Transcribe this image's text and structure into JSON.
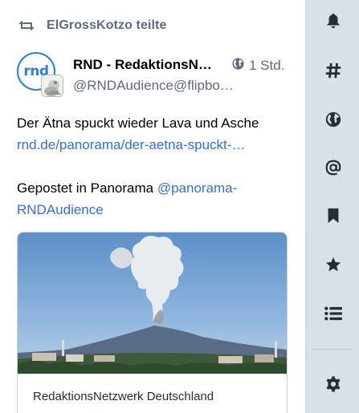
{
  "status": {
    "reblog_label": "ElGrossKotzo teilte",
    "display_name": "RND - RedaktionsNetzwerk Deutschland",
    "account": "@RNDAudience@flipboard.com",
    "time": "1 Std.",
    "avatar_logo_text": "rnd",
    "content": {
      "line1": "Der Ätna spuckt wieder Lava und Asche",
      "link": "rnd.de/panorama/der-aetna-spuckt-wieder-lava-und-asche",
      "posted_prefix": "Gepostet in Panorama ",
      "mention": "@panorama-RNDAudience"
    },
    "card": {
      "provider": "RedaktionsNetzwerk Deutschland",
      "image_description": "volcano-eruption-photo"
    }
  },
  "sidebar": {
    "items": [
      {
        "icon": "bell-icon"
      },
      {
        "icon": "hashtag-icon"
      },
      {
        "icon": "globe-icon"
      },
      {
        "icon": "at-icon"
      },
      {
        "icon": "bookmark-icon"
      },
      {
        "icon": "star-icon"
      },
      {
        "icon": "list-icon"
      },
      {
        "icon": "gear-icon"
      }
    ]
  },
  "colors": {
    "sidebar_bg": "#d9e1e8",
    "link": "#3a6cd6",
    "muted": "#606984",
    "icon": "#282c37"
  }
}
